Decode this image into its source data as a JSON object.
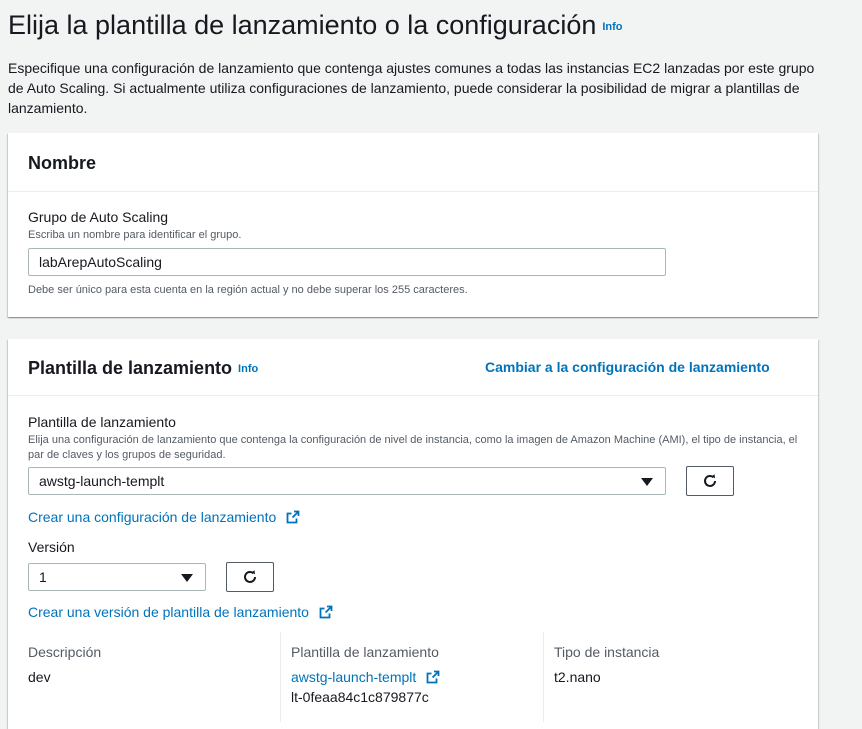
{
  "page": {
    "title": "Elija la plantilla de lanzamiento o la configuración",
    "info": "Info",
    "description": "Especifique una configuración de lanzamiento que contenga ajustes comunes a todas las instancias EC2 lanzadas por este grupo de Auto Scaling. Si actualmente utiliza configuraciones de lanzamiento, puede considerar la posibilidad de migrar a plantillas de lanzamiento."
  },
  "name_section": {
    "title": "Nombre",
    "group_label": "Grupo de Auto Scaling",
    "group_help": "Escriba un nombre para identificar el grupo.",
    "group_value": "labArepAutoScaling",
    "constraint": "Debe ser único para esta cuenta en la región actual y no debe superar los 255 caracteres."
  },
  "template_section": {
    "title": "Plantilla de lanzamiento",
    "info": "Info",
    "switch_link": "Cambiar a la configuración de lanzamiento",
    "template_label": "Plantilla de lanzamiento",
    "template_help": "Elija una configuración de lanzamiento que contenga la configuración de nivel de instancia, como la imagen de Amazon Machine (AMI), el tipo de instancia, el par de claves y los grupos de seguridad.",
    "template_value": "awstg-launch-templt",
    "create_config_link": "Crear una configuración de lanzamiento",
    "version_label": "Versión",
    "version_value": "1",
    "create_version_link": "Crear una versión de plantilla de lanzamiento",
    "details": {
      "description_label": "Descripción",
      "description_value": "dev",
      "template_label": "Plantilla de lanzamiento",
      "template_link": "awstg-launch-templt",
      "template_id": "lt-0feaa84c1c879877c",
      "instance_type_label": "Tipo de instancia",
      "instance_type_value": "t2.nano"
    }
  },
  "colors": {
    "link": "#0073bb",
    "background": "#f2f3f3",
    "text": "#16191f"
  }
}
